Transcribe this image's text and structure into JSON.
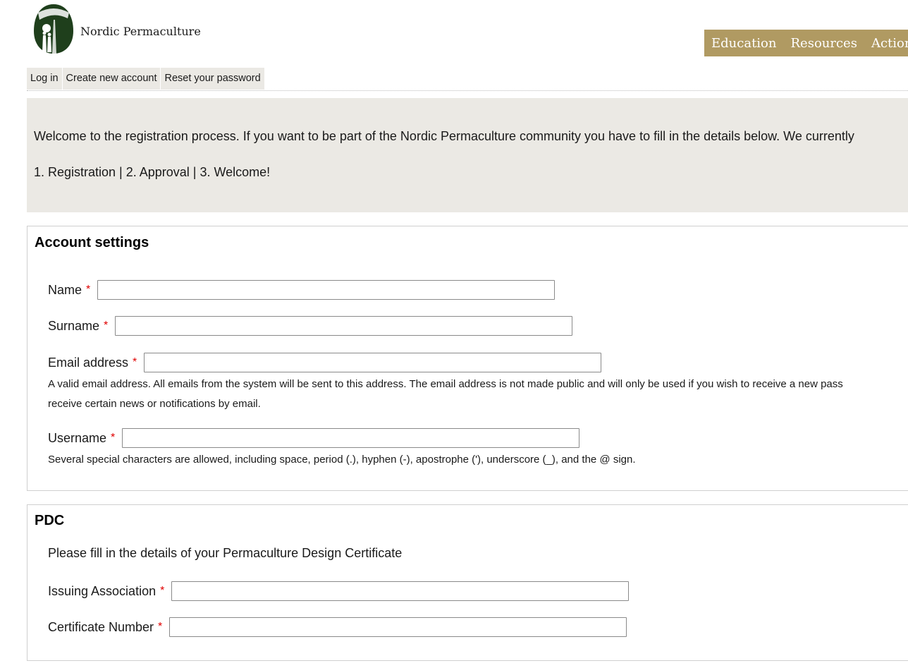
{
  "header": {
    "site_name": "Nordic Permaculture",
    "logo_icon": "tree-family-logo-icon",
    "nav": [
      {
        "label": "Education"
      },
      {
        "label": "Resources"
      },
      {
        "label": "Action"
      }
    ],
    "nav_color": "#b09a62"
  },
  "tabs": [
    {
      "label": "Log in"
    },
    {
      "label": "Create new account"
    },
    {
      "label": "Reset your password"
    }
  ],
  "welcome": {
    "text": "Welcome to the registration process. If you want to be part of the Nordic Permaculture community you have to fill in the details below. We currently",
    "steps": "1. Registration | 2. Approval | 3. Welcome!"
  },
  "account_settings": {
    "legend": "Account settings",
    "required_marker": "*",
    "fields": {
      "name": {
        "label": "Name",
        "value": ""
      },
      "surname": {
        "label": "Surname",
        "value": ""
      },
      "email": {
        "label": "Email address",
        "value": "",
        "description_line1": "A valid email address. All emails from the system will be sent to this address. The email address is not made public and will only be used if you wish to receive a new pass",
        "description_line2": "receive certain news or notifications by email."
      },
      "username": {
        "label": "Username",
        "value": "",
        "description": "Several special characters are allowed, including space, period (.), hyphen (-), apostrophe ('), underscore (_), and the @ sign."
      }
    }
  },
  "pdc": {
    "legend": "PDC",
    "intro": "Please fill in the details of your Permaculture Design Certificate",
    "required_marker": "*",
    "fields": {
      "issuing_association": {
        "label": "Issuing Association",
        "value": ""
      },
      "certificate_number": {
        "label": "Certificate Number",
        "value": ""
      }
    }
  }
}
